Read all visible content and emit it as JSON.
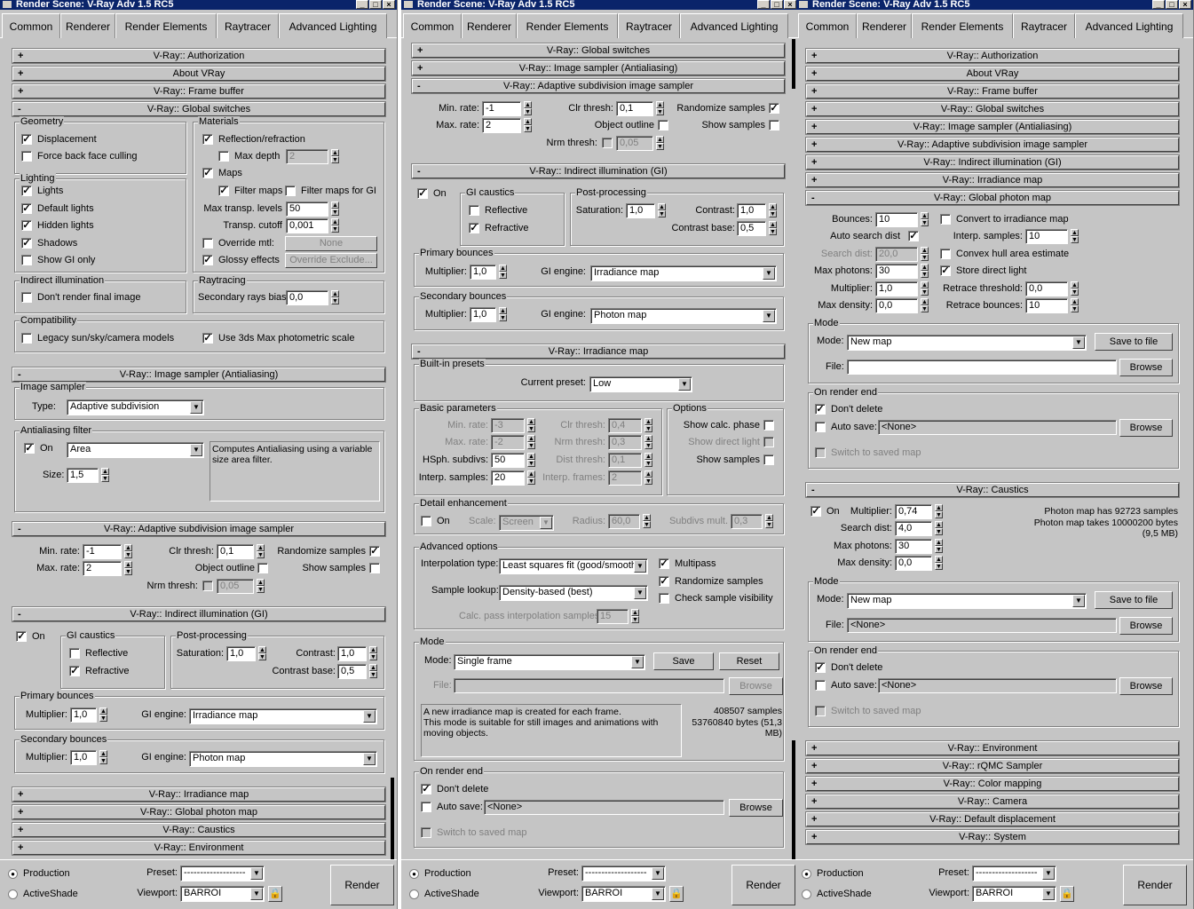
{
  "window_title": "Render Scene: V-Ray Adv 1.5 RC5",
  "tabs": [
    "Common",
    "Renderer",
    "Render Elements",
    "Raytracer",
    "Advanced Lighting"
  ],
  "bottom": {
    "production": "Production",
    "activeshade": "ActiveShade",
    "preset_label": "Preset:",
    "preset_value": "-------------------",
    "viewport_label": "Viewport:",
    "viewport_value": "BARROI",
    "render": "Render"
  },
  "p1": {
    "r_auth": "V-Ray:: Authorization",
    "r_about": "About VRay",
    "r_frame": "V-Ray:: Frame buffer",
    "r_global": "V-Ray:: Global switches",
    "g_geometry": "Geometry",
    "displacement": "Displacement",
    "force_backface": "Force back face culling",
    "g_lighting": "Lighting",
    "lights": "Lights",
    "default_lights": "Default lights",
    "hidden_lights": "Hidden lights",
    "shadows": "Shadows",
    "show_gi_only": "Show GI only",
    "g_materials": "Materials",
    "refl_refr": "Reflection/refraction",
    "max_depth": "Max depth",
    "max_depth_val": "2",
    "maps": "Maps",
    "filter_maps": "Filter maps",
    "filter_maps_gi": "Filter maps for GI",
    "max_transp": "Max transp. levels",
    "max_transp_val": "50",
    "transp_cutoff": "Transp. cutoff",
    "transp_cutoff_val": "0,001",
    "override_mtl": "Override mtl:",
    "none_btn": "None",
    "glossy": "Glossy effects",
    "override_exclude": "Override Exclude...",
    "g_indirect": "Indirect illumination",
    "dont_render_final": "Don't render final image",
    "g_raytracing": "Raytracing",
    "sec_bias": "Secondary rays bias",
    "sec_bias_val": "0,0",
    "g_compat": "Compatibility",
    "legacy": "Legacy sun/sky/camera models",
    "use_3ds": "Use 3ds Max photometric scale",
    "r_imgsampler": "V-Ray:: Image sampler (Antialiasing)",
    "g_img_sampler": "Image sampler",
    "type_lbl": "Type:",
    "type_val": "Adaptive subdivision",
    "g_aa": "Antialiasing filter",
    "on": "On",
    "filter_val": "Area",
    "filter_desc": "Computes Antialiasing using a variable size area filter.",
    "size_lbl": "Size:",
    "size_val": "1,5",
    "r_adaptive": "V-Ray:: Adaptive subdivision image sampler",
    "min_rate": "Min. rate:",
    "min_rate_val": "-1",
    "max_rate": "Max. rate:",
    "max_rate_val": "2",
    "clr_thresh": "Clr thresh:",
    "clr_thresh_val": "0,1",
    "obj_outline": "Object outline",
    "nrm_thresh": "Nrm thresh:",
    "nrm_thresh_val": "0,05",
    "randomize": "Randomize samples",
    "show_samples": "Show samples",
    "r_gi": "V-Ray:: Indirect illumination (GI)",
    "gi_on": "On",
    "g_gicaustics": "GI caustics",
    "reflective": "Reflective",
    "refractive": "Refractive",
    "g_post": "Post-processing",
    "saturation": "Saturation:",
    "saturation_val": "1,0",
    "contrast": "Contrast:",
    "contrast_val": "1,0",
    "contrast_base": "Contrast base:",
    "contrast_base_val": "0,5",
    "g_primary": "Primary bounces",
    "multiplier": "Multiplier:",
    "mult_val": "1,0",
    "gi_engine": "GI engine:",
    "primary_engine": "Irradiance map",
    "g_secondary": "Secondary bounces",
    "secondary_engine": "Photon map",
    "r_irr": "V-Ray:: Irradiance map",
    "r_photon": "V-Ray:: Global photon map",
    "r_caustics": "V-Ray:: Caustics",
    "r_env": "V-Ray:: Environment"
  },
  "p2": {
    "r_global": "V-Ray:: Global switches",
    "r_imgsampler": "V-Ray:: Image sampler (Antialiasing)",
    "r_adaptive": "V-Ray:: Adaptive subdivision image sampler",
    "min_rate": "Min. rate:",
    "min_rate_val": "-1",
    "max_rate": "Max. rate:",
    "max_rate_val": "2",
    "clr_thresh": "Clr thresh:",
    "clr_thresh_val": "0,1",
    "obj_outline": "Object outline",
    "nrm_thresh": "Nrm thresh:",
    "nrm_thresh_val": "0,05",
    "randomize": "Randomize samples",
    "show_samples": "Show samples",
    "r_gi": "V-Ray:: Indirect illumination (GI)",
    "gi_on": "On",
    "g_gicaustics": "GI caustics",
    "reflective": "Reflective",
    "refractive": "Refractive",
    "g_post": "Post-processing",
    "saturation": "Saturation:",
    "saturation_val": "1,0",
    "contrast": "Contrast:",
    "contrast_val": "1,0",
    "contrast_base": "Contrast base:",
    "contrast_base_val": "0,5",
    "g_primary": "Primary bounces",
    "multiplier": "Multiplier:",
    "mult_val": "1,0",
    "gi_engine": "GI engine:",
    "primary_engine": "Irradiance map",
    "g_secondary": "Secondary bounces",
    "secondary_engine": "Photon map",
    "r_irr": "V-Ray:: Irradiance map",
    "g_presets": "Built-in presets",
    "current_preset": "Current preset:",
    "preset_val": "Low",
    "g_basic": "Basic parameters",
    "min_rate2_val": "-3",
    "max_rate2_val": "-2",
    "hsph": "HSph. subdivs:",
    "hsph_val": "50",
    "interp_samples": "Interp. samples:",
    "interp_samples_val": "20",
    "clr_thresh2_val": "0,4",
    "nrm_thresh2": "Nrm thresh:",
    "nrm_thresh2_val": "0,3",
    "dist_thresh": "Dist thresh:",
    "dist_thresh_val": "0,1",
    "interp_frames": "Interp. frames:",
    "interp_frames_val": "2",
    "g_options": "Options",
    "show_calc": "Show calc. phase",
    "show_direct": "Show direct light",
    "show_samples2": "Show samples",
    "g_detail": "Detail enhancement",
    "detail_on": "On",
    "scale": "Scale:",
    "scale_val": "Screen",
    "radius": "Radius:",
    "radius_val": "60,0",
    "subdivs_mult": "Subdivs mult.",
    "subdivs_mult_val": "0,3",
    "g_advanced": "Advanced options",
    "interp_type": "Interpolation type:",
    "interp_type_val": "Least squares fit (good/smooth)",
    "multipass": "Multipass",
    "randomize2": "Randomize samples",
    "sample_lookup": "Sample lookup:",
    "sample_lookup_val": "Density-based (best)",
    "check_vis": "Check sample visibility",
    "calc_pass": "Calc. pass interpolation samples:",
    "calc_pass_val": "15",
    "g_mode": "Mode",
    "mode_lbl": "Mode:",
    "mode_val": "Single frame",
    "save": "Save",
    "reset": "Reset",
    "file_lbl": "File:",
    "browse": "Browse",
    "mode_desc": "A new irradiance map is created for each frame.\nThis mode is suitable for still images and animations with moving objects.",
    "samples_info": "408507 samples\n53760840 bytes (51,3\nMB)",
    "g_onrender": "On render end",
    "dont_delete": "Don't delete",
    "auto_save": "Auto save:",
    "auto_save_val": "<None>",
    "switch_saved": "Switch to saved map"
  },
  "p3": {
    "r_auth": "V-Ray:: Authorization",
    "r_about": "About VRay",
    "r_frame": "V-Ray:: Frame buffer",
    "r_global": "V-Ray:: Global switches",
    "r_imgsampler": "V-Ray:: Image sampler (Antialiasing)",
    "r_adaptive": "V-Ray:: Adaptive subdivision image sampler",
    "r_gi": "V-Ray:: Indirect illumination (GI)",
    "r_irr": "V-Ray:: Irradiance map",
    "r_photon": "V-Ray:: Global photon map",
    "bounces": "Bounces:",
    "bounces_val": "10",
    "auto_search": "Auto search dist",
    "search_dist": "Search dist:",
    "search_dist_val": "20,0",
    "max_photons": "Max photons:",
    "max_photons_val": "30",
    "multiplier": "Multiplier:",
    "mult_val": "1,0",
    "max_density": "Max density:",
    "max_density_val": "0,0",
    "convert": "Convert to irradiance map",
    "interp_samples": "Interp. samples:",
    "interp_samples_val": "10",
    "convex": "Convex hull area estimate",
    "store_direct": "Store direct light",
    "retrace_thresh": "Retrace threshold:",
    "retrace_thresh_val": "0,0",
    "retrace_bounces": "Retrace bounces:",
    "retrace_bounces_val": "10",
    "g_mode": "Mode",
    "mode_lbl": "Mode:",
    "mode_val": "New map",
    "save_file": "Save to file",
    "file_lbl": "File:",
    "browse": "Browse",
    "g_onrender": "On render end",
    "dont_delete": "Don't delete",
    "auto_save": "Auto save:",
    "auto_save_val": "<None>",
    "switch_saved": "Switch to saved map",
    "r_caustics": "V-Ray:: Caustics",
    "c_on": "On",
    "c_mult_val": "0,74",
    "c_search_val": "4,0",
    "c_maxph_val": "30",
    "c_maxden_val": "0,0",
    "caustics_info": "Photon map has 92723 samples\nPhoton map takes 10000200 bytes\n(9,5 MB)",
    "c_file_val": "<None>",
    "r_env": "V-Ray:: Environment",
    "r_rqmc": "V-Ray:: rQMC Sampler",
    "r_color": "V-Ray:: Color mapping",
    "r_camera": "V-Ray:: Camera",
    "r_displace": "V-Ray:: Default displacement",
    "r_system": "V-Ray:: System"
  }
}
